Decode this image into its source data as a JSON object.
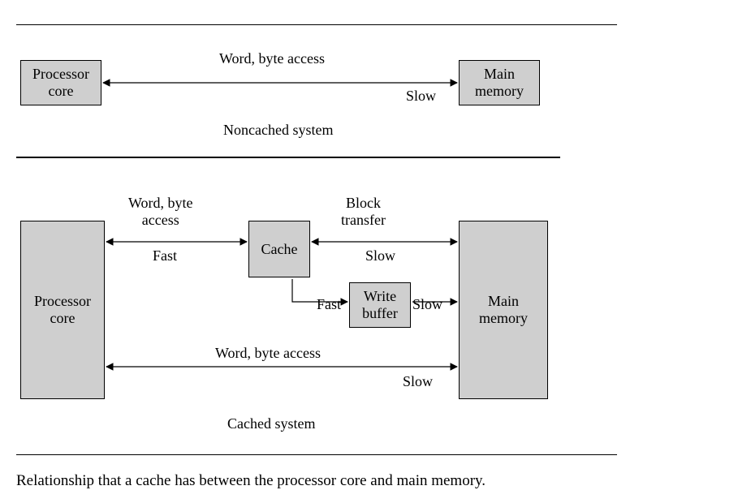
{
  "boxes": {
    "proc_top": "Processor\ncore",
    "main_top": "Main\nmemory",
    "proc_bot": "Processor\ncore",
    "main_bot": "Main\nmemory",
    "cache": "Cache",
    "write_buffer": "Write\nbuffer"
  },
  "labels": {
    "top_access": "Word, byte access",
    "top_slow": "Slow",
    "noncached": "Noncached system",
    "mid_access": "Word, byte\naccess",
    "mid_fast": "Fast",
    "block_transfer": "Block\ntransfer",
    "block_slow": "Slow",
    "wb_fast": "Fast",
    "wb_slow": "Slow",
    "bot_access": "Word, byte access",
    "bot_slow": "Slow",
    "cached": "Cached system"
  },
  "caption": "Relationship that a cache has between the processor core and main memory."
}
